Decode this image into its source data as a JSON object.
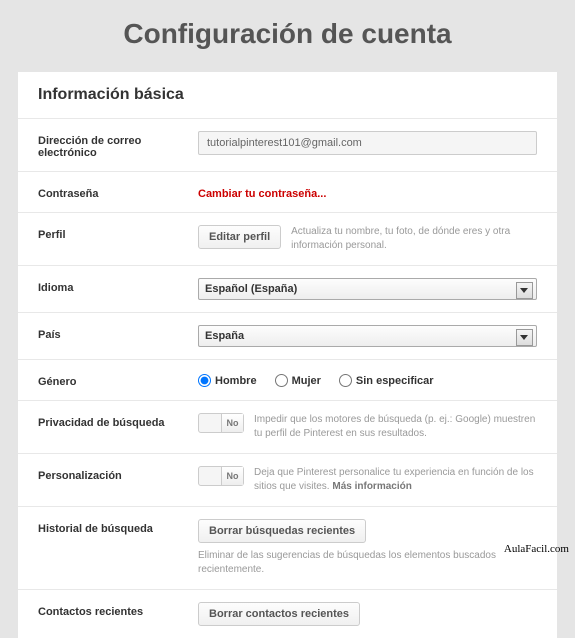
{
  "page_title": "Configuración de cuenta",
  "section_title": "Información básica",
  "rows": {
    "email": {
      "label": "Dirección de correo electrónico",
      "value": "tutorialpinterest101@gmail.com"
    },
    "password": {
      "label": "Contraseña",
      "link": "Cambiar tu contraseña..."
    },
    "profile": {
      "label": "Perfil",
      "button": "Editar perfil",
      "helper": "Actualiza tu nombre, tu foto, de dónde eres y otra información personal."
    },
    "language": {
      "label": "Idioma",
      "value": "Español (España)"
    },
    "country": {
      "label": "País",
      "value": "España"
    },
    "gender": {
      "label": "Género",
      "options": {
        "male": "Hombre",
        "female": "Mujer",
        "unspec": "Sin especificar"
      },
      "selected": "male"
    },
    "search_privacy": {
      "label": "Privacidad de búsqueda",
      "toggle": "No",
      "helper": "Impedir que los motores de búsqueda (p. ej.: Google) muestren tu perfil de Pinterest en sus resultados."
    },
    "personalization": {
      "label": "Personalización",
      "toggle": "No",
      "helper": "Deja que Pinterest personalice tu experiencia en función de los sitios que visites. ",
      "helper_more": "Más información"
    },
    "search_history": {
      "label": "Historial de búsqueda",
      "button": "Borrar búsquedas recientes",
      "helper": "Eliminar de las sugerencias de búsquedas los elementos buscados recientemente."
    },
    "recent_contacts": {
      "label": "Contactos recientes",
      "button": "Borrar contactos recientes"
    }
  },
  "watermark": "AulaFacil.com"
}
